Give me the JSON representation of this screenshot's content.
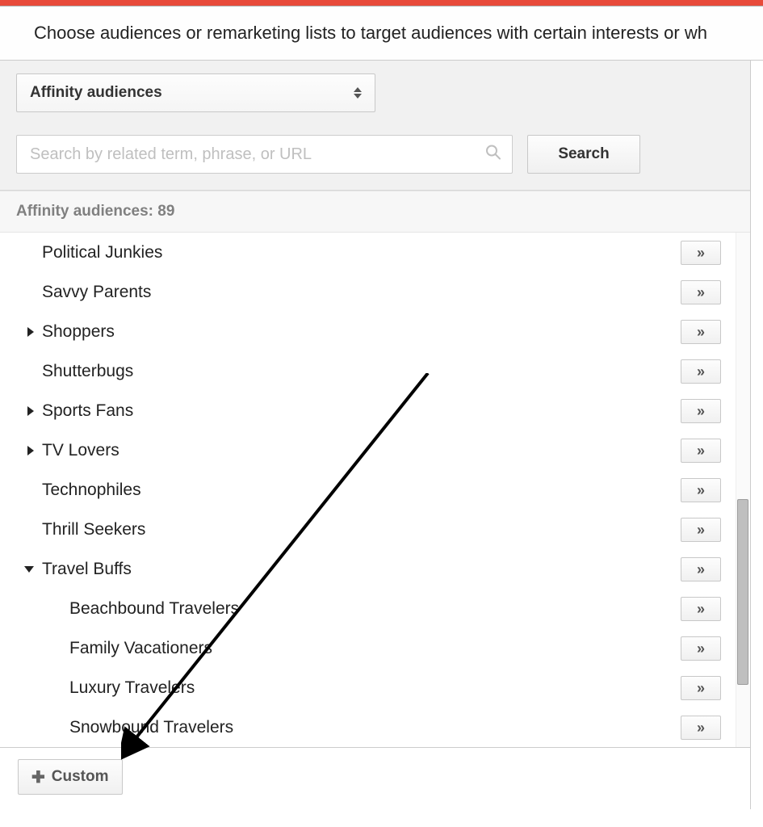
{
  "header": {
    "title": "Choose audiences or remarketing lists to target audiences with certain interests or wh"
  },
  "dropdown": {
    "label": "Affinity audiences"
  },
  "search": {
    "placeholder": "Search by related term, phrase, or URL",
    "button_label": "Search"
  },
  "count_bar": {
    "label": "Affinity audiences:",
    "count": "89"
  },
  "list": [
    {
      "label": "Political Junkies",
      "expandable": false,
      "expanded": false,
      "child": false
    },
    {
      "label": "Savvy Parents",
      "expandable": false,
      "expanded": false,
      "child": false
    },
    {
      "label": "Shoppers",
      "expandable": true,
      "expanded": false,
      "child": false
    },
    {
      "label": "Shutterbugs",
      "expandable": false,
      "expanded": false,
      "child": false
    },
    {
      "label": "Sports Fans",
      "expandable": true,
      "expanded": false,
      "child": false
    },
    {
      "label": "TV Lovers",
      "expandable": true,
      "expanded": false,
      "child": false
    },
    {
      "label": "Technophiles",
      "expandable": false,
      "expanded": false,
      "child": false
    },
    {
      "label": "Thrill Seekers",
      "expandable": false,
      "expanded": false,
      "child": false
    },
    {
      "label": "Travel Buffs",
      "expandable": true,
      "expanded": true,
      "child": false
    },
    {
      "label": "Beachbound Travelers",
      "expandable": false,
      "expanded": false,
      "child": true
    },
    {
      "label": "Family Vacationers",
      "expandable": false,
      "expanded": false,
      "child": true
    },
    {
      "label": "Luxury Travelers",
      "expandable": false,
      "expanded": false,
      "child": true
    },
    {
      "label": "Snowbound Travelers",
      "expandable": false,
      "expanded": false,
      "child": true
    }
  ],
  "action_glyph": "»",
  "footer": {
    "custom_label": "Custom"
  }
}
